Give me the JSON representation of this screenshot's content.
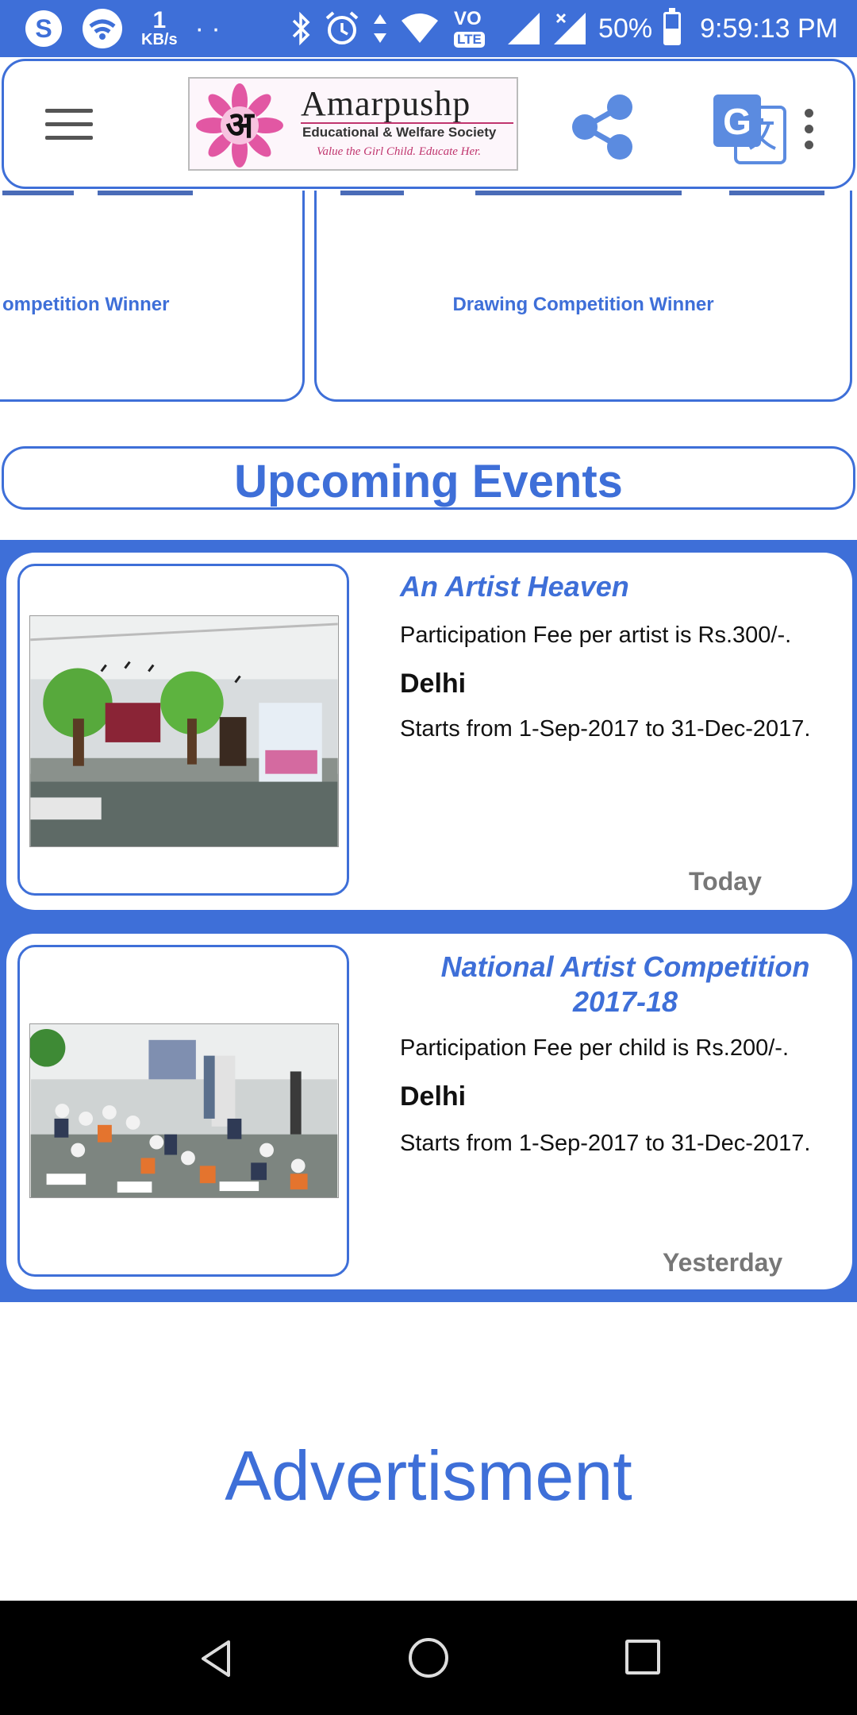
{
  "status_bar": {
    "speed_value": "1",
    "speed_unit": "KB/s",
    "dots": "· ·",
    "volte_label": "VO",
    "lte_label": "LTE",
    "battery_percent": "50%",
    "battery_level": 0.5,
    "time": "9:59:13 PM",
    "icons": [
      "skype-icon",
      "wifi-icon",
      "bluetooth-icon",
      "alarm-icon",
      "data-arrows-icon",
      "wifi-signal-icon",
      "volte-icon",
      "cell-signal-icon",
      "cell-signal-x-icon",
      "battery-icon"
    ]
  },
  "app_bar": {
    "logo_text": "Amarpushp",
    "logo_subtitle": "Educational & Welfare Society",
    "logo_tagline": "Value the Girl Child. Educate Her.",
    "logo_glyph": "अ",
    "icons": [
      "menu-icon",
      "share-icon",
      "translate-icon",
      "more-vert-icon"
    ]
  },
  "top_cards": [
    {
      "label": "ompetition Winner"
    },
    {
      "label": "Drawing Competition Winner"
    }
  ],
  "upcoming": {
    "heading": "Upcoming Events"
  },
  "events": [
    {
      "title": "An Artist Heaven",
      "fee": "Participation Fee per artist is Rs.300/-.",
      "city": "Delhi",
      "dates": "Starts from 1-Sep-2017 to 31-Dec-2017.",
      "when": "Today"
    },
    {
      "title": "National Artist Competition 2017-18",
      "fee": "Participation Fee per child is Rs.200/-.",
      "city": "Delhi",
      "dates": "Starts from 1-Sep-2017 to 31-Dec-2017.",
      "when": "Yesterday"
    }
  ],
  "advertisement": {
    "label": "Advertisment"
  },
  "colors": {
    "accent": "#3e6fd8",
    "muted_text": "#777777",
    "nav_background": "#000000"
  }
}
